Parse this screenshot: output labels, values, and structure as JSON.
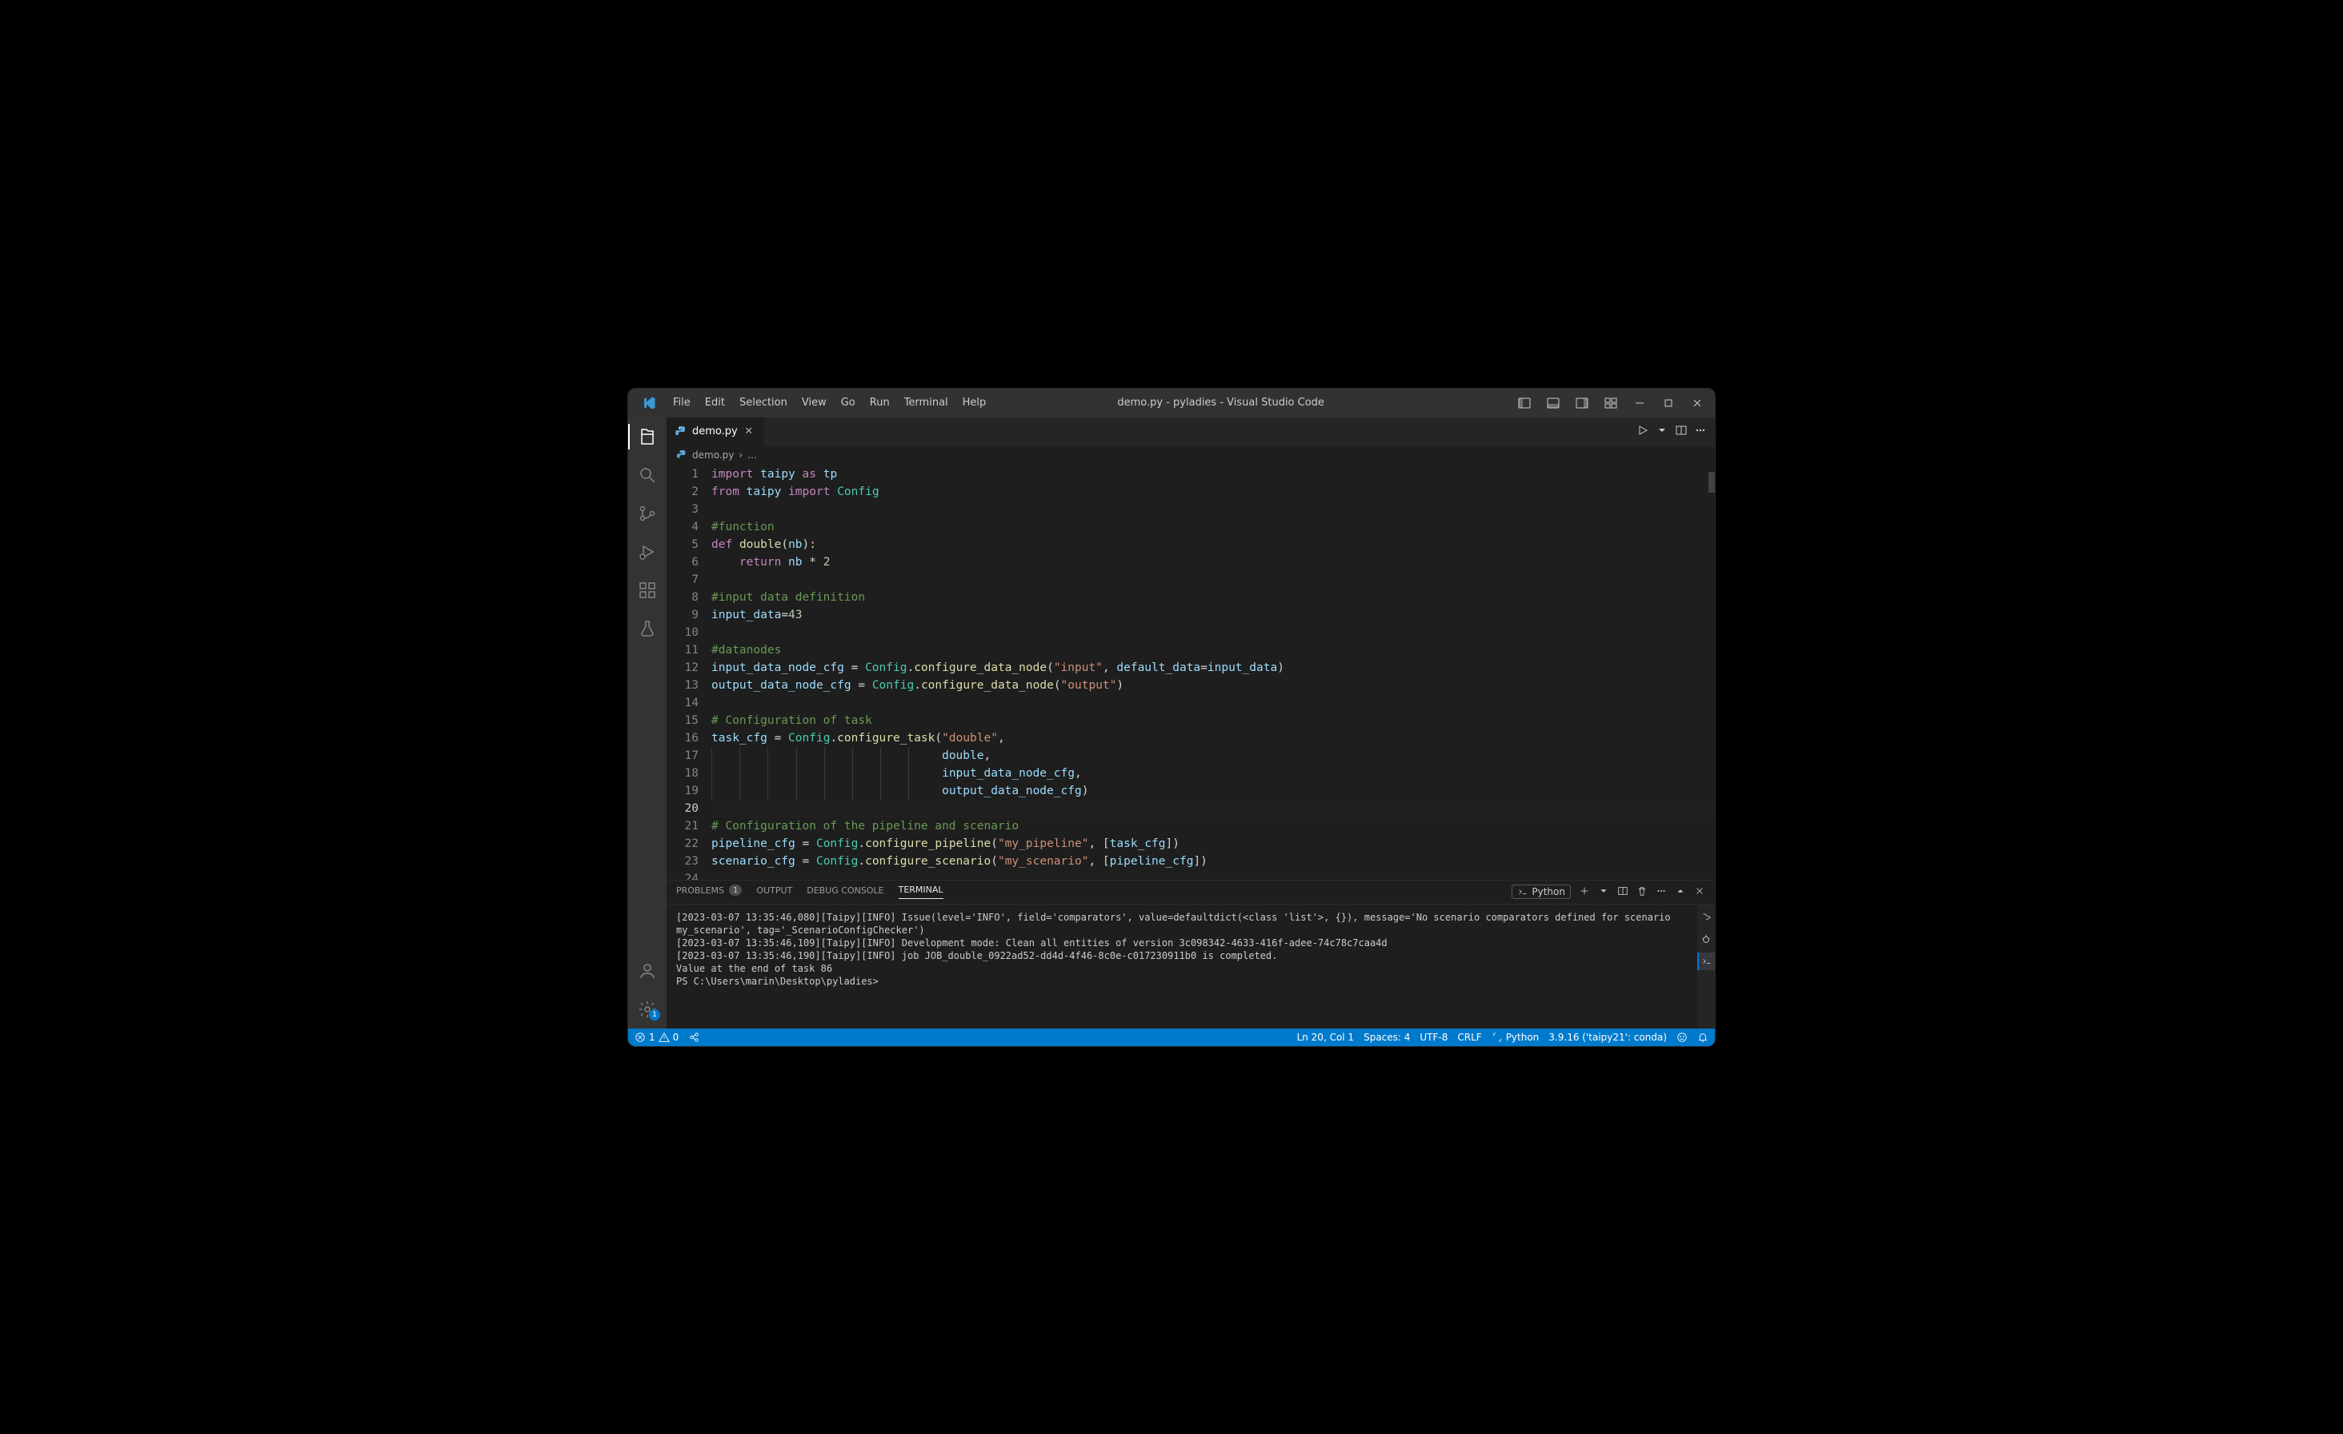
{
  "title": "demo.py - pyladies - Visual Studio Code",
  "menu": [
    "File",
    "Edit",
    "Selection",
    "View",
    "Go",
    "Run",
    "Terminal",
    "Help"
  ],
  "tab": {
    "file": "demo.py",
    "icon": "python"
  },
  "breadcrumb": {
    "file": "demo.py",
    "rest": "..."
  },
  "gutter_lines": 24,
  "current_line": 20,
  "code": [
    [
      [
        "kw",
        "import"
      ],
      [
        "op",
        " "
      ],
      [
        "ident",
        "taipy"
      ],
      [
        "op",
        " "
      ],
      [
        "kw",
        "as"
      ],
      [
        "op",
        " "
      ],
      [
        "ident",
        "tp"
      ]
    ],
    [
      [
        "kw",
        "from"
      ],
      [
        "op",
        " "
      ],
      [
        "ident",
        "taipy"
      ],
      [
        "op",
        " "
      ],
      [
        "kw",
        "import"
      ],
      [
        "op",
        " "
      ],
      [
        "mod",
        "Config"
      ]
    ],
    [],
    [
      [
        "cmt",
        "#function"
      ]
    ],
    [
      [
        "kw",
        "def"
      ],
      [
        "op",
        " "
      ],
      [
        "func",
        "double"
      ],
      [
        "op",
        "("
      ],
      [
        "param",
        "nb"
      ],
      [
        "op",
        "):"
      ]
    ],
    [
      [
        "op",
        "    "
      ],
      [
        "kw",
        "return"
      ],
      [
        "op",
        " "
      ],
      [
        "ident",
        "nb"
      ],
      [
        "op",
        " * "
      ],
      [
        "num",
        "2"
      ]
    ],
    [],
    [
      [
        "cmt",
        "#input data definition"
      ]
    ],
    [
      [
        "ident",
        "input_data"
      ],
      [
        "op",
        "="
      ],
      [
        "num",
        "43"
      ]
    ],
    [],
    [
      [
        "cmt",
        "#datanodes"
      ]
    ],
    [
      [
        "ident",
        "input_data_node_cfg"
      ],
      [
        "op",
        " = "
      ],
      [
        "mod",
        "Config"
      ],
      [
        "op",
        "."
      ],
      [
        "func",
        "configure_data_node"
      ],
      [
        "op",
        "("
      ],
      [
        "str",
        "\"input\""
      ],
      [
        "op",
        ", "
      ],
      [
        "param",
        "default_data"
      ],
      [
        "op",
        "="
      ],
      [
        "ident",
        "input_data"
      ],
      [
        "op",
        ")"
      ]
    ],
    [
      [
        "ident",
        "output_data_node_cfg"
      ],
      [
        "op",
        " = "
      ],
      [
        "mod",
        "Config"
      ],
      [
        "op",
        "."
      ],
      [
        "func",
        "configure_data_node"
      ],
      [
        "op",
        "("
      ],
      [
        "str",
        "\"output\""
      ],
      [
        "op",
        ")"
      ]
    ],
    [],
    [
      [
        "cmt",
        "# Configuration of task"
      ]
    ],
    [
      [
        "ident",
        "task_cfg"
      ],
      [
        "op",
        " = "
      ],
      [
        "mod",
        "Config"
      ],
      [
        "op",
        "."
      ],
      [
        "func",
        "configure_task"
      ],
      [
        "op",
        "("
      ],
      [
        "str",
        "\"double\""
      ],
      [
        "op",
        ","
      ]
    ],
    [
      [
        "op",
        "                                 "
      ],
      [
        "ident",
        "double"
      ],
      [
        "op",
        ","
      ]
    ],
    [
      [
        "op",
        "                                 "
      ],
      [
        "ident",
        "input_data_node_cfg"
      ],
      [
        "op",
        ","
      ]
    ],
    [
      [
        "op",
        "                                 "
      ],
      [
        "ident",
        "output_data_node_cfg"
      ],
      [
        "op",
        ")"
      ]
    ],
    [],
    [
      [
        "cmt",
        "# Configuration of the pipeline and scenario"
      ]
    ],
    [
      [
        "ident",
        "pipeline_cfg"
      ],
      [
        "op",
        " = "
      ],
      [
        "mod",
        "Config"
      ],
      [
        "op",
        "."
      ],
      [
        "func",
        "configure_pipeline"
      ],
      [
        "op",
        "("
      ],
      [
        "str",
        "\"my_pipeline\""
      ],
      [
        "op",
        ", ["
      ],
      [
        "ident",
        "task_cfg"
      ],
      [
        "op",
        "])"
      ]
    ],
    [
      [
        "ident",
        "scenario_cfg"
      ],
      [
        "op",
        " = "
      ],
      [
        "mod",
        "Config"
      ],
      [
        "op",
        "."
      ],
      [
        "func",
        "configure_scenario"
      ],
      [
        "op",
        "("
      ],
      [
        "str",
        "\"my_scenario\""
      ],
      [
        "op",
        ", ["
      ],
      [
        "ident",
        "pipeline_cfg"
      ],
      [
        "op",
        "])"
      ]
    ],
    []
  ],
  "panel": {
    "tabs": {
      "problems": "Problems",
      "problems_count": "1",
      "output": "Output",
      "debug": "Debug Console",
      "terminal": "Terminal"
    },
    "term_label": "Python",
    "lines": [
      "[2023-03-07 13:35:46,080][Taipy][INFO] Issue(level='INFO', field='comparators', value=defaultdict(<class 'list'>, {}), message='No scenario comparators defined for scenario my_scenario', tag='_ScenarioConfigChecker')",
      "[2023-03-07 13:35:46,109][Taipy][INFO] Development mode: Clean all entities of version 3c098342-4633-416f-adee-74c78c7caa4d",
      "[2023-03-07 13:35:46,190][Taipy][INFO] job JOB_double_0922ad52-dd4d-4f46-8c0e-c017230911b0 is completed.",
      "Value at the end of task 86",
      "PS C:\\Users\\marin\\Desktop\\pyladies>"
    ]
  },
  "status": {
    "errors": "1",
    "warnings": "0",
    "ln_col": "Ln 20, Col 1",
    "spaces": "Spaces: 4",
    "encoding": "UTF-8",
    "eol": "CRLF",
    "lang": "Python",
    "interpreter": "3.9.16 ('taipy21': conda)"
  },
  "activity_badge": "1"
}
